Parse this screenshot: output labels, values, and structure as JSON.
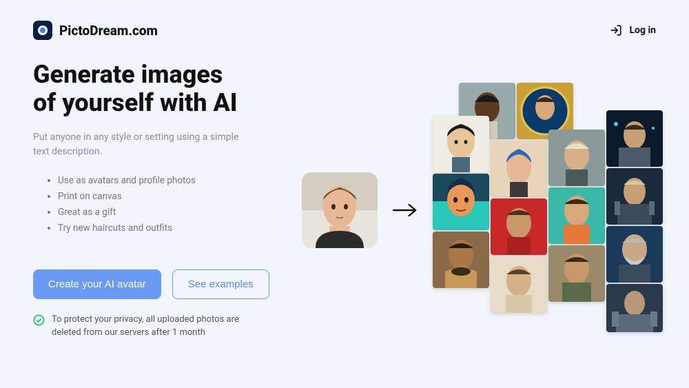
{
  "header": {
    "brand": "PictoDream.com",
    "login_label": "Log in"
  },
  "hero": {
    "headline_line1": "Generate images",
    "headline_line2": "of yourself with AI",
    "subtext": "Put anyone in any style or setting using a simple text description.",
    "features": [
      "Use as avatars and profile photos",
      "Print on canvas",
      "Great as a gift",
      "Try new haircuts and outfits"
    ],
    "cta_primary": "Create your AI avatar",
    "cta_secondary": "See examples",
    "privacy_note": "To protect your privacy, all uploaded photos are deleted from our servers after 1 month"
  },
  "illustration": {
    "source_alt": "user-photo",
    "arrow_alt": "transforms-into",
    "tiles": [
      "avatar-realistic-1",
      "avatar-icon-gold",
      "avatar-asian-portrait",
      "avatar-blue-hair",
      "avatar-platinum",
      "avatar-scifi-1",
      "avatar-popart",
      "avatar-red-bg",
      "avatar-orange-shirt",
      "avatar-scifi-2",
      "avatar-tribal",
      "avatar-beige",
      "avatar-soldier",
      "avatar-grey-beard",
      "avatar-mech"
    ]
  },
  "colors": {
    "accent": "#6a9bf4",
    "bg": "#f2f5fc",
    "success": "#22c55e"
  }
}
